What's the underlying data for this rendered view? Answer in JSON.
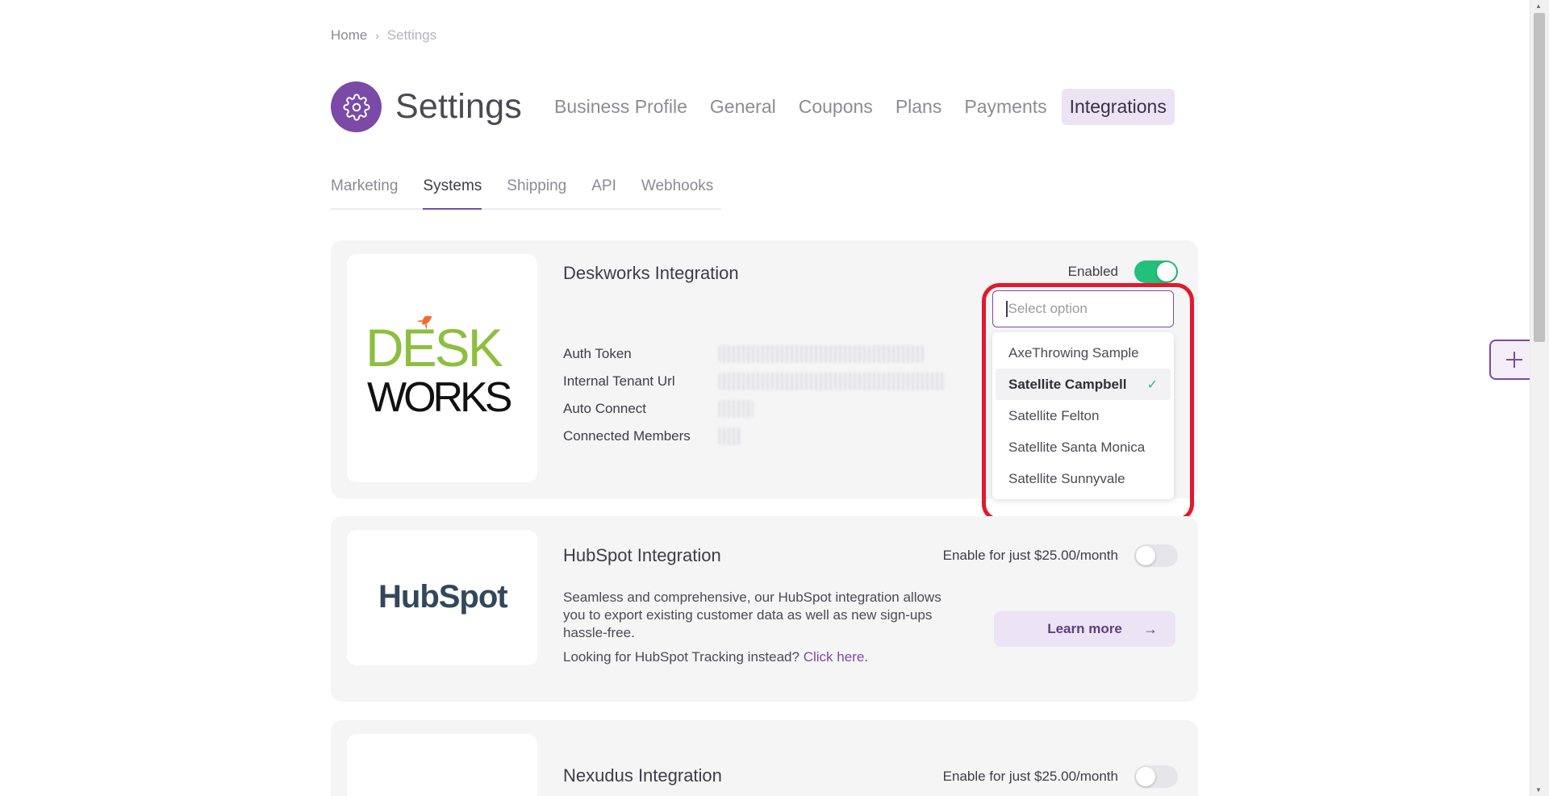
{
  "breadcrumb": {
    "home": "Home",
    "current": "Settings"
  },
  "header": {
    "title": "Settings",
    "tabs": [
      {
        "label": "Business Profile"
      },
      {
        "label": "General"
      },
      {
        "label": "Coupons"
      },
      {
        "label": "Plans"
      },
      {
        "label": "Payments"
      },
      {
        "label": "Integrations"
      }
    ],
    "active_tab": "Integrations"
  },
  "sub_tabs": [
    {
      "label": "Marketing"
    },
    {
      "label": "Systems"
    },
    {
      "label": "Shipping"
    },
    {
      "label": "API"
    },
    {
      "label": "Webhooks"
    }
  ],
  "active_sub_tab": "Systems",
  "deskworks": {
    "title": "Deskworks Integration",
    "logo_text_top": "DESK",
    "logo_text_bottom": "WORKS",
    "toggle_label": "Enabled",
    "enabled": true,
    "fields": [
      {
        "label": "Auth Token"
      },
      {
        "label": "Internal Tenant Url"
      },
      {
        "label": "Auto Connect"
      },
      {
        "label": "Connected Members"
      }
    ],
    "select": {
      "placeholder": "Select option",
      "options": [
        {
          "label": "AxeThrowing Sample",
          "selected": false
        },
        {
          "label": "Satellite Campbell",
          "selected": true
        },
        {
          "label": "Satellite Felton",
          "selected": false
        },
        {
          "label": "Satellite Santa Monica",
          "selected": false
        },
        {
          "label": "Satellite Sunnyvale",
          "selected": false
        }
      ]
    }
  },
  "hubspot": {
    "title": "HubSpot Integration",
    "logo_text": "HubSpot",
    "toggle_label": "Enable for just $25.00/month",
    "enabled": false,
    "description": "Seamless and comprehensive, our HubSpot integration allows you to export existing customer data as well as new sign-ups hassle-free.",
    "tracking_text": "Looking for HubSpot Tracking instead?",
    "tracking_link": "Click here",
    "learn_more": "Learn more"
  },
  "nexudus": {
    "title": "Nexudus Integration",
    "toggle_label": "Enable for just $25.00/month",
    "enabled": false
  },
  "colors": {
    "brand": "#7a4aa6",
    "toggle_on": "#22c07a",
    "highlight": "#e3192b"
  }
}
